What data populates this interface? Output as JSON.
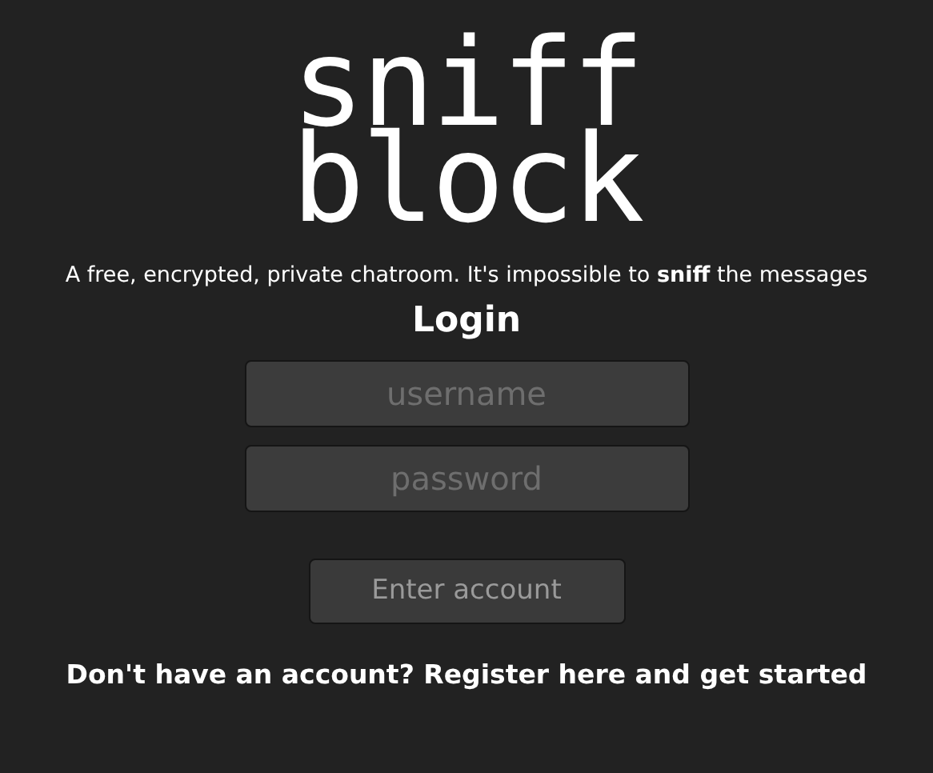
{
  "logo": [
    "sniff",
    "block"
  ],
  "tagline": "A free, encrypted, private chatroom. It's impossible to **sniff** the messages",
  "heading": "Login",
  "fields": [
    {
      "placeholder": "username"
    },
    {
      "placeholder": "password"
    }
  ],
  "submit_button": "Enter account",
  "register_link": "Don't have an account? Register here and get started"
}
